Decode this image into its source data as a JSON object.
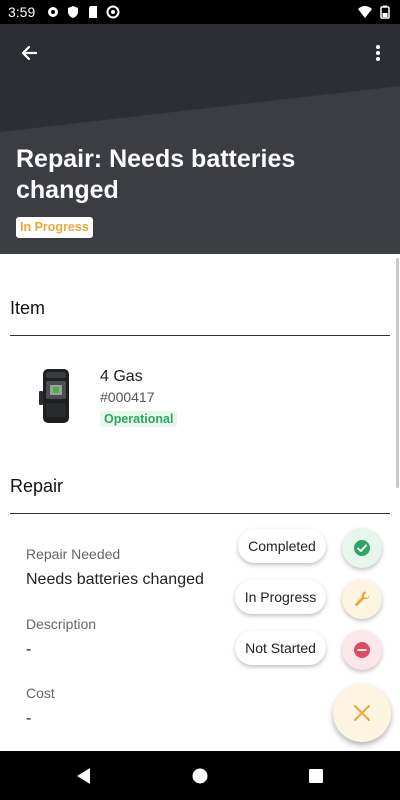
{
  "status_bar": {
    "time": "3:59",
    "left_icons": [
      "settings-icon",
      "shield-icon",
      "sd-card-icon",
      "data-saver-icon"
    ],
    "right_icons": [
      "wifi-icon",
      "battery-icon"
    ]
  },
  "header": {
    "title": "Repair: Needs batteries changed",
    "status": "In Progress",
    "status_color": "#e8a93a",
    "background_color": "#3b3d43"
  },
  "item_section": {
    "heading": "Item",
    "item": {
      "name": "4 Gas",
      "number": "#000417",
      "status": "Operational",
      "status_color": "#2ea663"
    }
  },
  "repair_section": {
    "heading": "Repair",
    "fields": [
      {
        "label": "Repair Needed",
        "value": "Needs batteries changed"
      },
      {
        "label": "Description",
        "value": "-"
      },
      {
        "label": "Cost",
        "value": "-"
      }
    ]
  },
  "status_menu": {
    "options": [
      {
        "label": "Completed",
        "icon": "check-circle-icon",
        "color": "#2ea663"
      },
      {
        "label": "In Progress",
        "icon": "wrench-icon",
        "color": "#e8a93a"
      },
      {
        "label": "Not Started",
        "icon": "minus-circle-icon",
        "color": "#e04a5f"
      }
    ],
    "close_icon": "close-icon"
  },
  "nav_bar": {
    "buttons": [
      "back-triangle-icon",
      "home-circle-icon",
      "recents-square-icon"
    ]
  }
}
